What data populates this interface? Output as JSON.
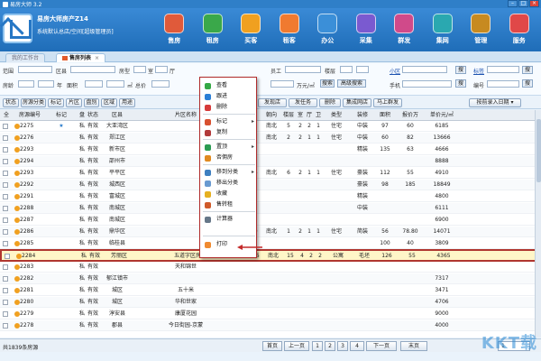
{
  "app": {
    "title": "易房大师 3.2",
    "brand_title": "易房大师房产Z14",
    "brand_subtitle": "系统默认总店/空间[超级管理员]",
    "watermark": "KKT载"
  },
  "colors": {
    "accent": "#2f7fc8",
    "highlight_border": "#b0362f",
    "row_highlight": "#fff6c8"
  },
  "nav": [
    {
      "label": "售房",
      "icon": "house-sale-icon",
      "color": "#e05a3a"
    },
    {
      "label": "租房",
      "icon": "house-rent-icon",
      "color": "#3aa84a"
    },
    {
      "label": "买客",
      "icon": "buyer-icon",
      "color": "#f0a020"
    },
    {
      "label": "租客",
      "icon": "tenant-icon",
      "color": "#f07a30"
    },
    {
      "label": "办公",
      "icon": "office-icon",
      "color": "#3b8fd8"
    },
    {
      "label": "采集",
      "icon": "collect-icon",
      "color": "#7a5ad0"
    },
    {
      "label": "群发",
      "icon": "broadcast-icon",
      "color": "#d04a8a"
    },
    {
      "label": "集网",
      "icon": "network-icon",
      "color": "#2aa8b0"
    },
    {
      "label": "管理",
      "icon": "manage-icon",
      "color": "#c78a20"
    },
    {
      "label": "服务",
      "icon": "service-icon",
      "color": "#e04848"
    }
  ],
  "tabs": [
    {
      "label": "我的工作台"
    },
    {
      "label": "售房列表"
    }
  ],
  "filters": {
    "row1": [
      "范围",
      "区县",
      "房型",
      "室",
      "厅",
      "员工",
      "楼层",
      "小区",
      "标签"
    ],
    "row2": [
      "房龄",
      "年",
      "面积",
      "㎡",
      "总价",
      "万元/㎡"
    ],
    "row2_right": [
      "手机",
      "编号"
    ],
    "search_button": "搜索",
    "advanced_button": "高级搜索",
    "small_btn": "搜"
  },
  "toolbar": {
    "left": [
      "状态",
      "房源分类",
      "标记",
      "片区",
      "盘别",
      "区域",
      "用途"
    ],
    "right": [
      "发现店",
      "发任务",
      "删除",
      "集成网店",
      "马上群发"
    ],
    "sort": "按前录入日期 ▾"
  },
  "columns": [
    "全",
    "房源编号",
    "标记",
    "盘",
    "状态",
    "区县",
    "片区名称",
    "房龄",
    "朝向",
    "楼层",
    "室",
    "厅",
    "卫",
    "类型",
    "装修",
    "面积",
    "报价万",
    "单价元/㎡"
  ],
  "rows": [
    [
      "2275",
      "★",
      "私",
      "有效",
      "大亚湾区",
      "",
      "2012",
      "南北",
      "5",
      "2",
      "2",
      "1",
      "住宅",
      "中装",
      "97",
      "60",
      "6185"
    ],
    [
      "2276",
      "",
      "私",
      "有效",
      "郑江区",
      "",
      "1997",
      "南北",
      "2",
      "2",
      "1",
      "1",
      "住宅",
      "中装",
      "60",
      "82",
      "13666"
    ],
    [
      "2293",
      "",
      "私",
      "有效",
      "新市区",
      "",
      "",
      "",
      "",
      "",
      "",
      "",
      "",
      "精装",
      "135",
      "63",
      "4666"
    ],
    [
      "2294",
      "",
      "私",
      "有效",
      "邵州市",
      "",
      "",
      "",
      "",
      "",
      "",
      "",
      "",
      "",
      "",
      "",
      "8888"
    ],
    [
      "2293",
      "",
      "私",
      "有效",
      "平平区",
      "",
      "2014",
      "南北",
      "6",
      "2",
      "1",
      "1",
      "住宅",
      "豪装",
      "112",
      "55",
      "4910"
    ],
    [
      "2292",
      "",
      "私",
      "有效",
      "城西区",
      "",
      "",
      "",
      "",
      "",
      "",
      "",
      "",
      "豪装",
      "98",
      "185",
      "18849"
    ],
    [
      "2291",
      "",
      "私",
      "有效",
      "富城区",
      "",
      "",
      "",
      "",
      "",
      "",
      "",
      "",
      "精装",
      "",
      "",
      "4800"
    ],
    [
      "2288",
      "",
      "私",
      "有效",
      "南城区",
      "",
      "",
      "",
      "",
      "",
      "",
      "",
      "",
      "中装",
      "",
      "",
      "6111"
    ],
    [
      "2287",
      "",
      "私",
      "有效",
      "南城区",
      "",
      "",
      "",
      "",
      "",
      "",
      "",
      "",
      "",
      "",
      "",
      "6900"
    ],
    [
      "2286",
      "",
      "私",
      "有效",
      "鼎华区",
      "",
      "1990",
      "南北",
      "1",
      "2",
      "1",
      "1",
      "住宅",
      "简装",
      "56",
      "78.80",
      "14071"
    ],
    [
      "2285",
      "",
      "私",
      "有效",
      "临桂县",
      "",
      "",
      "",
      "",
      "",
      "",
      "",
      "",
      "",
      "100",
      "40",
      "3809"
    ],
    [
      "2284",
      "",
      "私",
      "有效",
      "芳丽区",
      "五道字区房",
      "2016",
      "南北",
      "15",
      "4",
      "2",
      "2",
      "公寓",
      "毛坯",
      "126",
      "55",
      "4365"
    ],
    [
      "2283",
      "",
      "私",
      "有效",
      "",
      "天和锦世",
      "",
      "",
      "",
      "",
      "",
      "",
      "",
      "",
      "",
      "",
      ""
    ],
    [
      "2282",
      "",
      "私",
      "有效",
      "郁江镇市",
      "",
      "",
      "",
      "",
      "",
      "",
      "",
      "",
      "",
      "",
      "",
      "7317"
    ],
    [
      "2281",
      "",
      "私",
      "有效",
      "城区",
      "五十米",
      "",
      "",
      "",
      "",
      "",
      "",
      "",
      "",
      "",
      "",
      "3471"
    ],
    [
      "2280",
      "",
      "私",
      "有效",
      "城区",
      "华和世家",
      "",
      "",
      "",
      "",
      "",
      "",
      "",
      "",
      "",
      "",
      "4706"
    ],
    [
      "2279",
      "",
      "私",
      "有效",
      "淳安县",
      "康厦花园",
      "",
      "",
      "",
      "",
      "",
      "",
      "",
      "",
      "",
      "",
      "9000"
    ],
    [
      "2278",
      "",
      "私",
      "有效",
      "郡县",
      "今日街园-京蒙",
      "",
      "",
      "",
      "",
      "",
      "",
      "",
      "",
      "",
      "",
      "4000"
    ]
  ],
  "context_menu": {
    "items": [
      {
        "label": "查看",
        "icon": "view-icon",
        "color": "#35a845"
      },
      {
        "label": "跟进",
        "icon": "follow-icon",
        "color": "#2c7fd6"
      },
      {
        "label": "删除",
        "icon": "delete-icon",
        "color": "#d63a3a"
      },
      {
        "label": "标记",
        "icon": "flag-icon",
        "color": "#d85030",
        "submenu": true
      },
      {
        "label": "复制",
        "icon": "copy-icon",
        "color": "#b23a3a"
      },
      {
        "label": "置顶",
        "icon": "pin-icon",
        "color": "#2c9c52",
        "submenu": true
      },
      {
        "label": "否佣房",
        "icon": "nocommission-icon",
        "color": "#e08a20"
      },
      {
        "label": "移到分类",
        "icon": "move-category-icon",
        "color": "#3f7fc0",
        "submenu": true
      },
      {
        "label": "移出分类",
        "icon": "remove-category-icon",
        "color": "#6a9ad0"
      },
      {
        "label": "收藏",
        "icon": "favorite-icon",
        "color": "#e6b020"
      },
      {
        "label": "售转租",
        "icon": "sale-to-rent-icon",
        "color": "#d05a2a"
      },
      {
        "label": "计算器",
        "icon": "calculator-icon",
        "color": "#667788"
      },
      {
        "label": "打印",
        "icon": "print-icon",
        "color": "#f08a30"
      }
    ],
    "arrow_symbol": "▸"
  },
  "status": {
    "total": "共1839条房源",
    "pager": [
      "首页",
      "上一页",
      "1",
      "2",
      "3",
      "4",
      "下一页",
      "末页"
    ],
    "page_value": "1"
  }
}
